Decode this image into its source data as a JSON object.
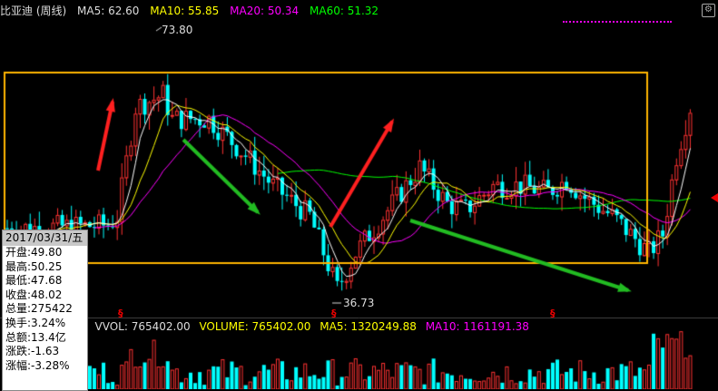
{
  "header": {
    "title": "比亚迪 (周线)",
    "ma5": "MA5: 62.60",
    "ma10": "MA10: 55.85",
    "ma20": "MA20: 50.34",
    "ma60": "MA60: 51.32",
    "settings_icon": "gear-icon"
  },
  "labels": {
    "high": "73.80",
    "low": "36.73",
    "s_marks": [
      "§",
      "§",
      "§"
    ]
  },
  "volume_header": {
    "prefix": ")",
    "vvol": "VVOL: 765402.00",
    "volume": "VOLUME: 765402.00",
    "ma5": "MA5: 1320249.88",
    "ma10": "MA10: 1161191.38"
  },
  "infobox": {
    "date": "2017/03/31/五",
    "open": "开盘:49.80",
    "high": "最高:50.25",
    "low": "最低:47.68",
    "close": "收盘:48.02",
    "volume": "总量:275422",
    "turnover": "换手:3.24%",
    "amount": "总额:13.4亿",
    "change": "涨跌:-1.63",
    "change_pct": "涨幅:-3.28%"
  },
  "colors": {
    "ma5": "#ffffff",
    "ma10": "#ffff00",
    "ma20": "#ff00ff",
    "ma60": "#00ff00",
    "up": "#ff3232",
    "down": "#00ffff",
    "annotation_box": "#ffb400",
    "arrow_up": "#ff2020",
    "arrow_down": "#22bb22"
  }
}
